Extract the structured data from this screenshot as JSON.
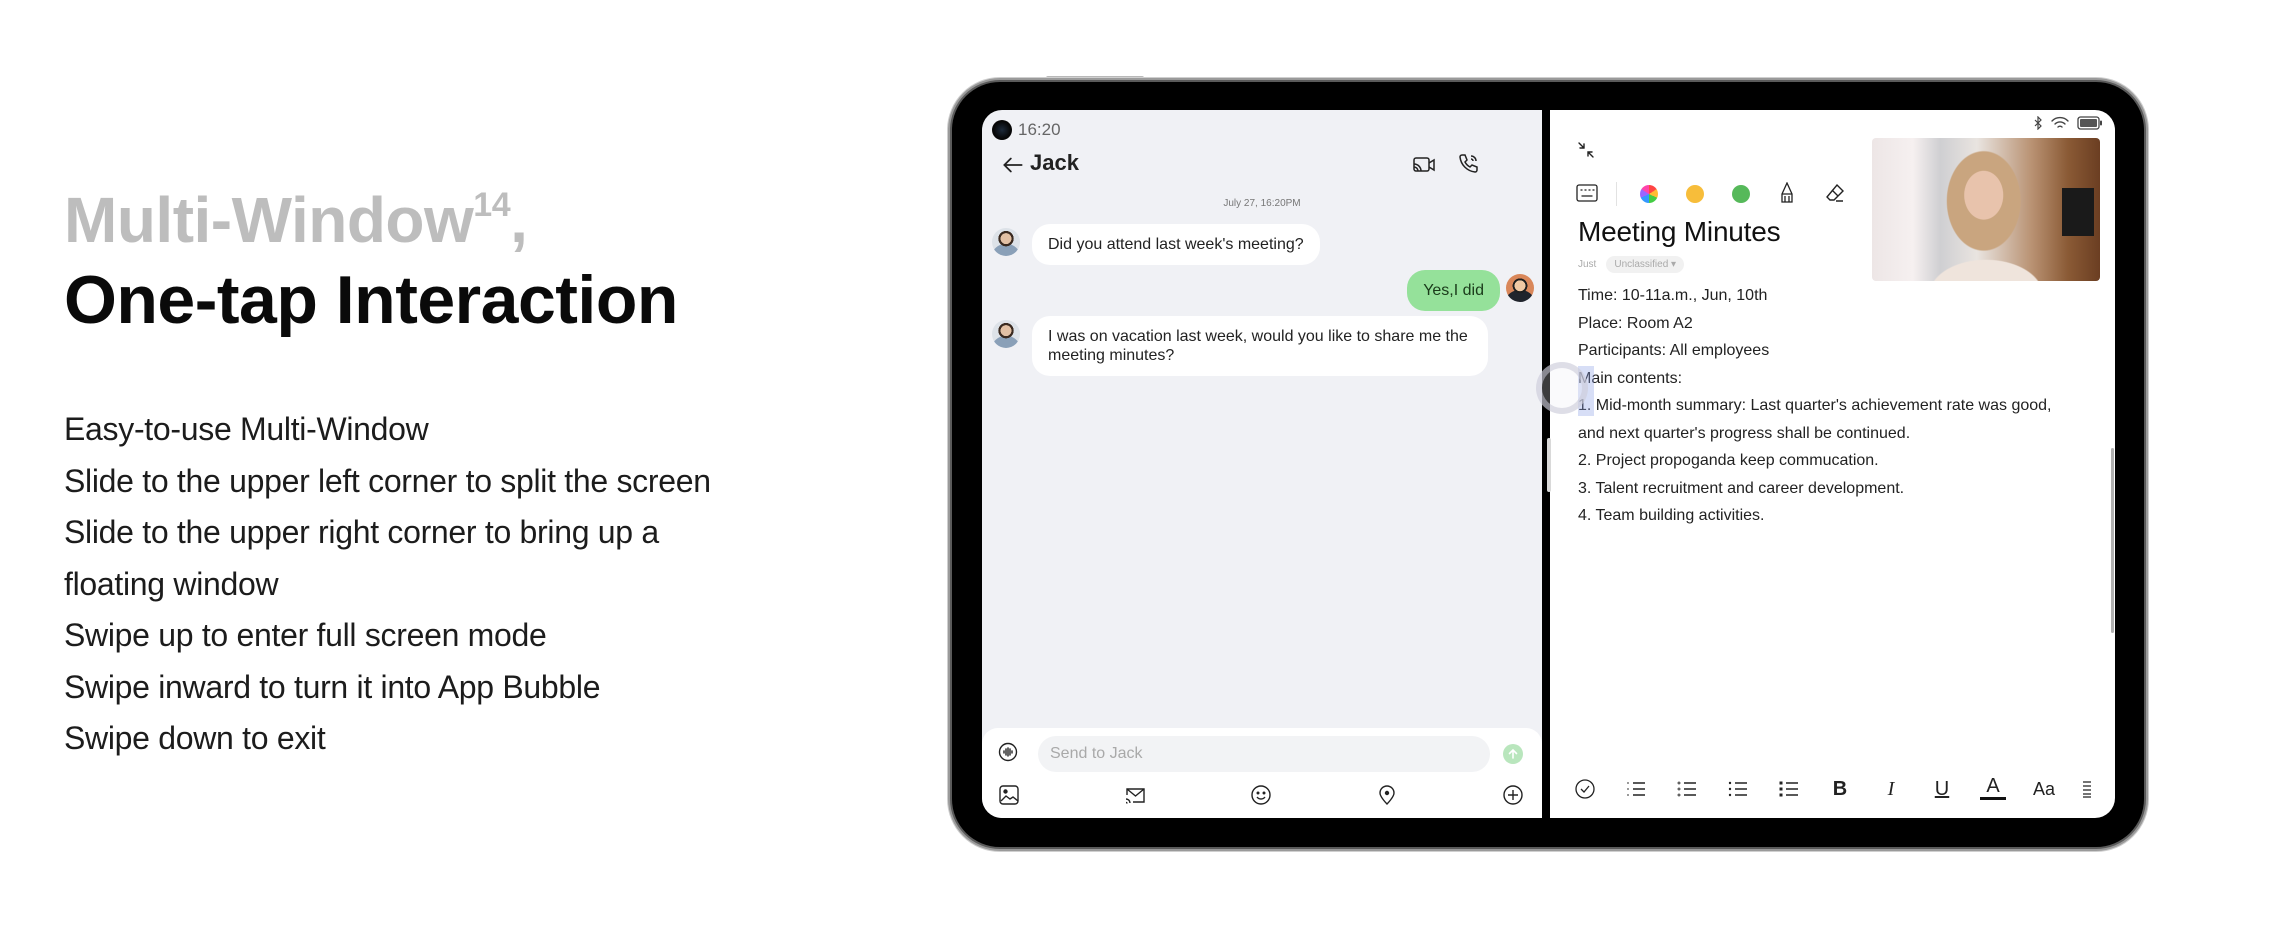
{
  "headline": {
    "line1": "Multi-Window",
    "line1_superscript": "14",
    "line1_suffix": ",",
    "line2": "One-tap Interaction"
  },
  "features": [
    "Easy-to-use Multi-Window",
    "Slide to the upper left corner to split the screen",
    "Slide to the upper right corner to bring up a",
    "floating window",
    "Swipe up to enter full screen mode",
    "Swipe inward to turn it into App Bubble",
    "Swipe down to exit"
  ],
  "chat": {
    "status_time": "16:20",
    "title": "Jack",
    "header_icons": [
      "back-arrow-icon",
      "video-call-icon",
      "phone-call-icon"
    ],
    "date_stamp": "July 27, 16:20PM",
    "messages": [
      {
        "from": "Jack",
        "side": "left",
        "text": "Did you attend last week's meeting?"
      },
      {
        "from": "me",
        "side": "right",
        "text": "Yes,I did"
      },
      {
        "from": "Jack",
        "side": "left",
        "text": "I was on vacation last week, would you like to share me the meeting minutes?"
      }
    ],
    "input_placeholder": "Send to Jack",
    "toolbar_icons": [
      "image-icon",
      "mail-cast-icon",
      "emoji-icon",
      "location-icon",
      "add-icon"
    ],
    "colors": {
      "bubble_mine": "#95e19a",
      "background": "#f0f1f5",
      "send_button": "#b9e6bd"
    }
  },
  "notes": {
    "status_icons": [
      "bluetooth-icon",
      "wifi-icon",
      "battery-icon"
    ],
    "pen_toolbar": [
      "keyboard-icon",
      "color-palette-icon",
      "yellow-color-icon",
      "green-color-icon",
      "pen-icon",
      "eraser-icon",
      "lasso-icon"
    ],
    "pen_colors": {
      "yellow": "#f7bd3a",
      "green": "#56b95a"
    },
    "title": "Meeting Minutes",
    "timestamp": "Just",
    "category": "Unclassified",
    "lines": [
      "Time: 10-11a.m., Jun, 10th",
      "Place: Room A2",
      "Participants: All employees",
      "Main contents:",
      "1. Mid-month summary: Last quarter's achievement rate was good,",
      "and next quarter's progress shall be continued.",
      "2. Project propoganda keep commucation.",
      "3. Talent recruitment and career development.",
      "4. Team building activities."
    ],
    "format_toolbar": {
      "checklist": "checklist-icon",
      "numbered": "numbered-list-icon",
      "lettered": "lettered-list-icon",
      "bulleted": "bulleted-list-icon",
      "bulleted_bold": "bulleted-list-bold-icon",
      "bold": "B",
      "italic": "I",
      "underline": "U",
      "font_color": "A",
      "font_size": "Aa",
      "align": "align-icon"
    }
  },
  "floating_window": {
    "content": "video call"
  }
}
